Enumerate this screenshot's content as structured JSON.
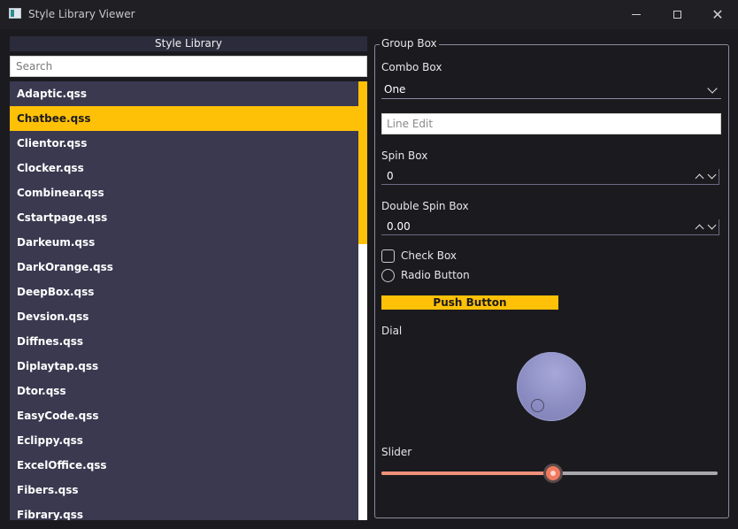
{
  "window": {
    "title": "Style Library Viewer",
    "icons": {
      "app": "app-window-icon",
      "minimize": "minimize-icon",
      "maximize": "maximize-icon",
      "close": "close-icon"
    },
    "close_glyph": "✕"
  },
  "library": {
    "header": "Style Library",
    "search_placeholder": "Search",
    "items": [
      "Adaptic.qss",
      "Chatbee.qss",
      "Clientor.qss",
      "Clocker.qss",
      "Combinear.qss",
      "Cstartpage.qss",
      "Darkeum.qss",
      "DarkOrange.qss",
      "DeepBox.qss",
      "Devsion.qss",
      "Diffnes.qss",
      "Diplaytap.qss",
      "Dtor.qss",
      "EasyCode.qss",
      "Eclippy.qss",
      "ExcelOffice.qss",
      "Fibers.qss",
      "Fibrary.qss"
    ],
    "selected_index": 1,
    "scroll_fraction_visible": 0.37
  },
  "preview": {
    "group_title": "Group Box",
    "combo_label": "Combo Box",
    "combo_value": "One",
    "line_edit_placeholder": "Line Edit",
    "spin_label": "Spin Box",
    "spin_value": "0",
    "double_spin_label": "Double Spin Box",
    "double_spin_value": "0.00",
    "checkbox_label": "Check Box",
    "checkbox_checked": false,
    "radio_label": "Radio Button",
    "radio_checked": false,
    "push_button_label": "Push Button",
    "dial_label": "Dial",
    "slider_label": "Slider",
    "slider_value_fraction": 0.51
  },
  "colors": {
    "accent": "#ffc107",
    "list_bg": "#3a3950",
    "window_bg": "#1b1b1f",
    "slider_fill": "#f2917a",
    "dial": "#8c8dc2"
  }
}
